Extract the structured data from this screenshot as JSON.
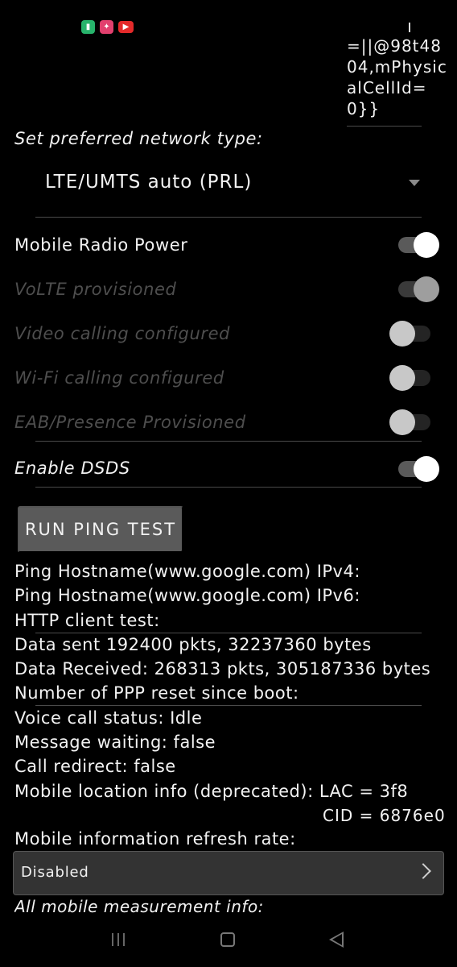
{
  "status_bar": {
    "icons": [
      {
        "name": "phone-clipboard-icon",
        "color": "#27b36b"
      },
      {
        "name": "pinned-app-icon",
        "color": "#e2406e"
      },
      {
        "name": "youtube-icon",
        "color": "#e42a2a"
      }
    ]
  },
  "cell_info_tail": "=||@98t4804,mPhysicalCellId=0}}",
  "network": {
    "label": "Set preferred network type:",
    "value": "LTE/UMTS auto (PRL)"
  },
  "toggles": [
    {
      "label": "Mobile Radio Power",
      "on": true,
      "enabled": true
    },
    {
      "label": "VoLTE provisioned",
      "on": true,
      "enabled": false
    },
    {
      "label": "Video calling configured",
      "on": false,
      "enabled": false
    },
    {
      "label": "Wi-Fi calling configured",
      "on": false,
      "enabled": false
    },
    {
      "label": "EAB/Presence Provisioned",
      "on": false,
      "enabled": false
    },
    {
      "label": "Enable DSDS",
      "on": true,
      "enabled": true
    }
  ],
  "ping_button": "RUN PING TEST",
  "info_lines": [
    "Ping Hostname(www.google.com) IPv4:",
    "Ping Hostname(www.google.com) IPv6:",
    "HTTP client test:",
    "Data sent 192400 pkts, 32237360 bytes",
    "Data Received: 268313 pkts, 305187336 bytes",
    "Number of PPP reset since boot:",
    "Voice call status: Idle",
    "Message waiting: false",
    "Call redirect: false",
    "Mobile location info (deprecated): LAC = 3f8"
  ],
  "cid_line": "CID = 6876e0",
  "refresh": {
    "label": "Mobile information refresh rate:",
    "value": "Disabled"
  },
  "measurement_label": "All mobile measurement info:"
}
